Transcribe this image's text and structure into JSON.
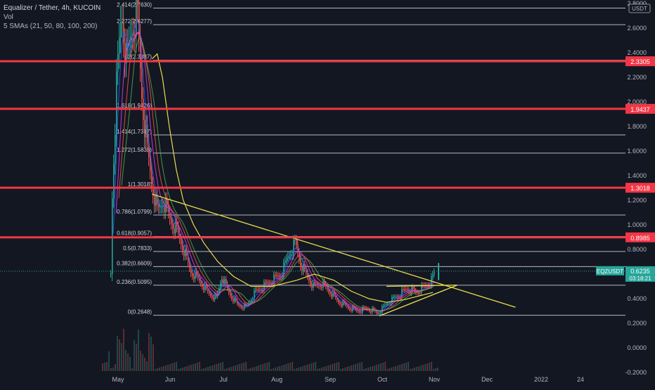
{
  "legend": {
    "title": "Equalizer / Tether, 4h, KUCOIN",
    "vol": "Vol",
    "smas": "5 SMAs (21, 50, 80, 100, 200)"
  },
  "price_axis": {
    "currency_badge": "USDT",
    "ticks": [
      "2.8000",
      "2.6000",
      "2.4000",
      "2.2000",
      "2.0000",
      "1.8000",
      "1.6000",
      "1.4000",
      "1.2000",
      "1.0000",
      "0.8000",
      "0.6000",
      "0.4000",
      "0.2000",
      "0.0000",
      "-0.2000"
    ]
  },
  "time_axis": {
    "labels": [
      "May",
      "Jun",
      "Jul",
      "Aug",
      "Sep",
      "Oct",
      "Nov",
      "Dec",
      "2022",
      "24"
    ]
  },
  "fib_levels": [
    {
      "label": "2.414(2.7630)",
      "price": 2.763
    },
    {
      "label": "2.272(2.6277)",
      "price": 2.6277
    },
    {
      "label": "2(2.3387)",
      "price": 2.3387
    },
    {
      "label": "1.618(1.9426)",
      "price": 1.9426
    },
    {
      "label": "1.414(1.7317)",
      "price": 1.7317
    },
    {
      "label": "1.272(1.5838)",
      "price": 1.5838
    },
    {
      "label": "1(1.3018)",
      "price": 1.3018
    },
    {
      "label": "0.786(1.0799)",
      "price": 1.0799
    },
    {
      "label": "0.618(0.9057)",
      "price": 0.9057
    },
    {
      "label": "0.5(0.7833)",
      "price": 0.7833
    },
    {
      "label": "0.382(0.6609)",
      "price": 0.6609
    },
    {
      "label": "0.236(0.5095)",
      "price": 0.5095
    },
    {
      "label": "0(0.2648)",
      "price": 0.2648
    }
  ],
  "horizontal_lines": [
    {
      "label": "2.3305",
      "price": 2.3305
    },
    {
      "label": "1.9437",
      "price": 1.9437
    },
    {
      "label": "1.3018",
      "price": 1.3018
    },
    {
      "label": "0.8985",
      "price": 0.8985
    }
  ],
  "current_price": {
    "symbol": "EQZUSDT",
    "price": "0.6235",
    "countdown": "03:18:21",
    "value": 0.6235
  },
  "colors": {
    "background": "#131722",
    "fib_line": "#d1d4dc",
    "horizontal_line": "#f23645",
    "trendline": "#e8de4c",
    "sma_200": "#e8de4c",
    "candle_up": "#26a69a",
    "candle_down": "#ef5350",
    "badge": "#26a69a"
  },
  "chart_data": {
    "type": "candlestick",
    "title": "Equalizer / Tether, 4h, KUCOIN",
    "y_range": [
      -0.2,
      2.8
    ],
    "price_path": [
      [
        "Apr 27",
        0.6
      ],
      [
        "Apr 30",
        1.3
      ],
      [
        "May 3",
        2.1
      ],
      [
        "May 6",
        2.75
      ],
      [
        "May 9",
        2.3
      ],
      [
        "May 12",
        2.6
      ],
      [
        "May 15",
        2.75
      ],
      [
        "May 18",
        2.0
      ],
      [
        "May 21",
        1.6
      ],
      [
        "May 24",
        1.3
      ],
      [
        "May 27",
        1.1
      ],
      [
        "May 30",
        1.2
      ],
      [
        "Jun 3",
        1.05
      ],
      [
        "Jun 7",
        0.95
      ],
      [
        "Jun 11",
        0.8
      ],
      [
        "Jun 15",
        0.62
      ],
      [
        "Jun 20",
        0.55
      ],
      [
        "Jun 25",
        0.45
      ],
      [
        "Jun 30",
        0.4
      ],
      [
        "Jul 3",
        0.58
      ],
      [
        "Jul 7",
        0.45
      ],
      [
        "Jul 12",
        0.35
      ],
      [
        "Jul 17",
        0.33
      ],
      [
        "Jul 22",
        0.45
      ],
      [
        "Jul 27",
        0.5
      ],
      [
        "Aug 1",
        0.55
      ],
      [
        "Aug 6",
        0.6
      ],
      [
        "Aug 10",
        0.75
      ],
      [
        "Aug 14",
        0.85
      ],
      [
        "Aug 17",
        0.68
      ],
      [
        "Aug 20",
        0.6
      ],
      [
        "Aug 24",
        0.5
      ],
      [
        "Aug 29",
        0.52
      ],
      [
        "Sep 3",
        0.45
      ],
      [
        "Sep 7",
        0.38
      ],
      [
        "Sep 13",
        0.33
      ],
      [
        "Sep 18",
        0.3
      ],
      [
        "Sep 24",
        0.32
      ],
      [
        "Sep 30",
        0.28
      ],
      [
        "Oct 5",
        0.36
      ],
      [
        "Oct 11",
        0.42
      ],
      [
        "Oct 17",
        0.48
      ],
      [
        "Oct 22",
        0.45
      ],
      [
        "Oct 27",
        0.5
      ],
      [
        "Oct 31",
        0.55
      ],
      [
        "Nov 2",
        0.6235
      ]
    ],
    "sma_200_path": [
      [
        "May 24",
        2.35
      ],
      [
        "May 27",
        2.39
      ],
      [
        "May 30",
        2.2
      ],
      [
        "Jun 3",
        1.8
      ],
      [
        "Jun 7",
        1.45
      ],
      [
        "Jun 11",
        1.2
      ],
      [
        "Jun 17",
        1.0
      ],
      [
        "Jun 23",
        0.85
      ],
      [
        "Jul 1",
        0.7
      ],
      [
        "Jul 10",
        0.58
      ],
      [
        "Jul 20",
        0.5
      ],
      [
        "Aug 1",
        0.5
      ],
      [
        "Aug 15",
        0.55
      ],
      [
        "Aug 25",
        0.6
      ],
      [
        "Sep 5",
        0.55
      ],
      [
        "Sep 15",
        0.46
      ],
      [
        "Sep 25",
        0.4
      ],
      [
        "Oct 5",
        0.37
      ],
      [
        "Oct 15",
        0.39
      ],
      [
        "Nov 1",
        0.45
      ]
    ],
    "trendlines": [
      {
        "from": [
          "May 24",
          1.25
        ],
        "to": [
          "Dec 19",
          0.33
        ]
      },
      {
        "from": [
          "Oct 1",
          0.26
        ],
        "to": [
          "Nov 15",
          0.51
        ]
      },
      {
        "from": [
          "Oct 5",
          0.5
        ],
        "to": [
          "Nov 15",
          0.51
        ]
      }
    ]
  }
}
